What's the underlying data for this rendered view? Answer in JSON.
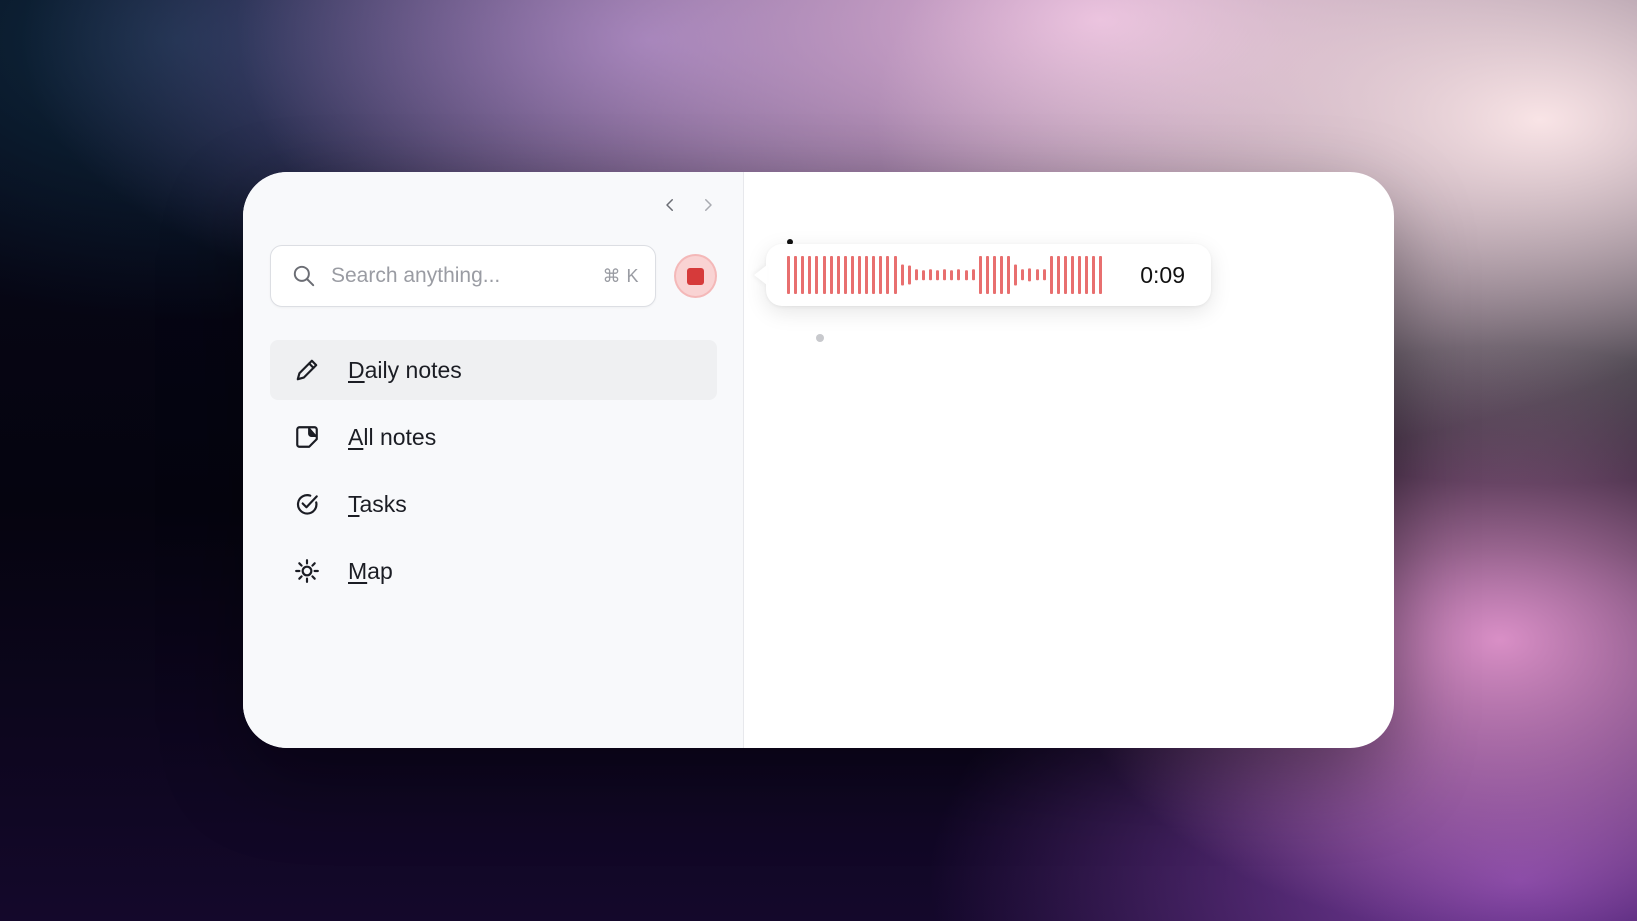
{
  "nav_history": {
    "back_icon": "chevron-left-icon",
    "forward_icon": "chevron-right-icon"
  },
  "search": {
    "placeholder": "Search anything...",
    "shortcut": "⌘ K",
    "icon": "search-icon"
  },
  "record": {
    "icon": "stop-icon",
    "color": "#d63a3a"
  },
  "sidebar": {
    "items": [
      {
        "label_mnemonic": "D",
        "label_rest": "aily notes",
        "icon": "pencil-icon",
        "active": true
      },
      {
        "label_mnemonic": "A",
        "label_rest": "ll notes",
        "icon": "note-icon",
        "active": false
      },
      {
        "label_mnemonic": "T",
        "label_rest": "asks",
        "icon": "check-circle-icon",
        "active": false
      },
      {
        "label_mnemonic": "M",
        "label_rest": "ap",
        "icon": "sun-icon",
        "active": false
      }
    ]
  },
  "recording": {
    "elapsed": "0:09",
    "waveform_color": "#e86f6f",
    "levels": [
      1,
      1,
      1,
      1,
      1,
      1,
      1,
      1,
      1,
      1,
      1,
      1,
      1,
      1,
      1,
      1,
      0.55,
      0.5,
      0.3,
      0.25,
      0.3,
      0.25,
      0.3,
      0.25,
      0.3,
      0.25,
      0.3,
      1,
      1,
      1,
      1,
      1,
      0.55,
      0.3,
      0.35,
      0.3,
      0.3,
      1,
      1,
      1,
      1,
      1,
      1,
      1,
      1
    ]
  },
  "colors": {
    "accent": "#d63a3a",
    "text": "#1b1d24",
    "muted": "#9a9ca3"
  }
}
